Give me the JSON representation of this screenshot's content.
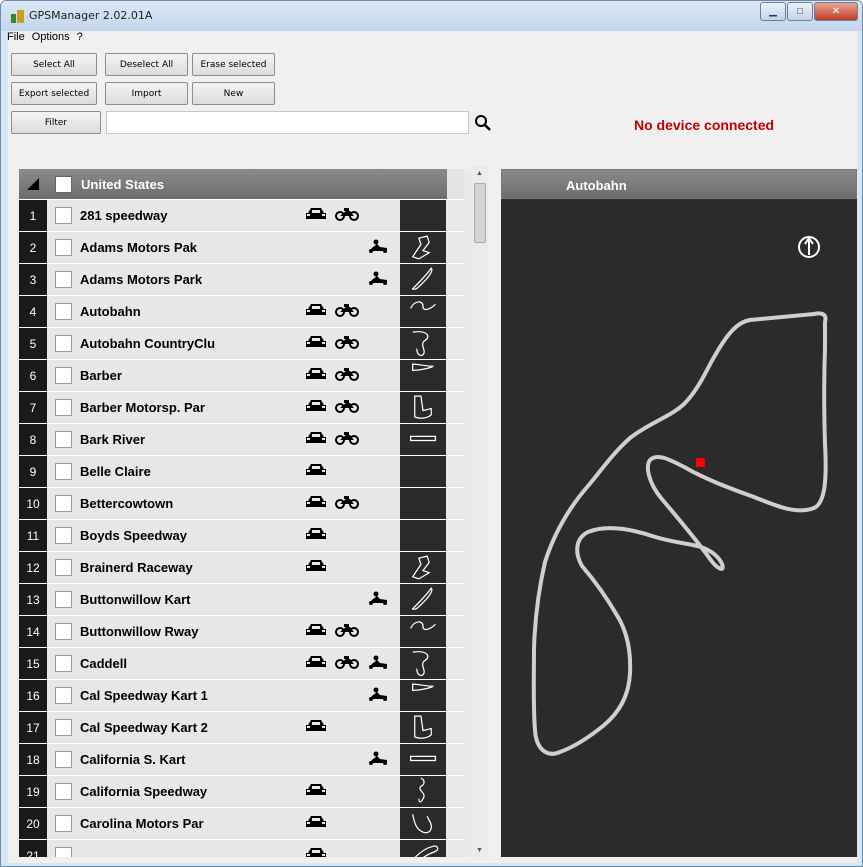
{
  "window": {
    "title": "GPSManager 2.02.01A"
  },
  "menu": [
    "File",
    "Options",
    "?"
  ],
  "toolbar": {
    "select_all": "Select All",
    "deselect_all": "Deselect All",
    "erase_selected": "Erase selected",
    "export_selected": "Export selected",
    "import": "Import",
    "new": "New",
    "filter": "Filter"
  },
  "filter_input": {
    "value": ""
  },
  "status": {
    "text": "No device connected"
  },
  "list": {
    "header": "United States",
    "rows": [
      {
        "n": "1",
        "name": "281 speedway",
        "types": [
          "car",
          "moto"
        ],
        "track": false
      },
      {
        "n": "2",
        "name": "Adams Motors Pak",
        "types": [
          "kart"
        ],
        "track": true
      },
      {
        "n": "3",
        "name": "Adams Motors Park",
        "types": [
          "kart"
        ],
        "track": true
      },
      {
        "n": "4",
        "name": "Autobahn",
        "types": [
          "car",
          "moto"
        ],
        "track": true
      },
      {
        "n": "5",
        "name": "Autobahn CountryClu",
        "types": [
          "car",
          "moto"
        ],
        "track": true
      },
      {
        "n": "6",
        "name": "Barber",
        "types": [
          "car",
          "moto"
        ],
        "track": true
      },
      {
        "n": "7",
        "name": "Barber Motorsp. Par",
        "types": [
          "car",
          "moto"
        ],
        "track": true
      },
      {
        "n": "8",
        "name": "Bark River",
        "types": [
          "car",
          "moto"
        ],
        "track": true
      },
      {
        "n": "9",
        "name": "Belle Claire",
        "types": [
          "car"
        ],
        "track": false
      },
      {
        "n": "10",
        "name": "Bettercowtown",
        "types": [
          "car",
          "moto"
        ],
        "track": false
      },
      {
        "n": "11",
        "name": "Boyds Speedway",
        "types": [
          "car"
        ],
        "track": false
      },
      {
        "n": "12",
        "name": "Brainerd Raceway",
        "types": [
          "car"
        ],
        "track": true
      },
      {
        "n": "13",
        "name": "Buttonwillow Kart",
        "types": [
          "kart"
        ],
        "track": true
      },
      {
        "n": "14",
        "name": "Buttonwillow Rway",
        "types": [
          "car",
          "moto"
        ],
        "track": true
      },
      {
        "n": "15",
        "name": "Caddell",
        "types": [
          "car",
          "moto",
          "kart"
        ],
        "track": true
      },
      {
        "n": "16",
        "name": "Cal Speedway Kart 1",
        "types": [
          "kart"
        ],
        "track": true
      },
      {
        "n": "17",
        "name": "Cal Speedway Kart 2",
        "types": [
          "car"
        ],
        "track": true
      },
      {
        "n": "18",
        "name": "California S. Kart",
        "types": [
          "kart"
        ],
        "track": true
      },
      {
        "n": "19",
        "name": "California Speedway",
        "types": [
          "car"
        ],
        "track": true
      },
      {
        "n": "20",
        "name": "Carolina Motors Par",
        "types": [
          "car"
        ],
        "track": true
      },
      {
        "n": "21",
        "name": "",
        "types": [
          "car"
        ],
        "track": true
      }
    ]
  },
  "map": {
    "title": "Autobahn",
    "compass_icon": "north-arrow-icon"
  },
  "icons": {
    "car": "car-icon",
    "moto": "motorcycle-icon",
    "kart": "kart-icon"
  },
  "colors": {
    "status": "#c00000",
    "marker": "#ff0000",
    "track_line": "#cfcfcf",
    "map_bg": "#2b2b2b"
  }
}
